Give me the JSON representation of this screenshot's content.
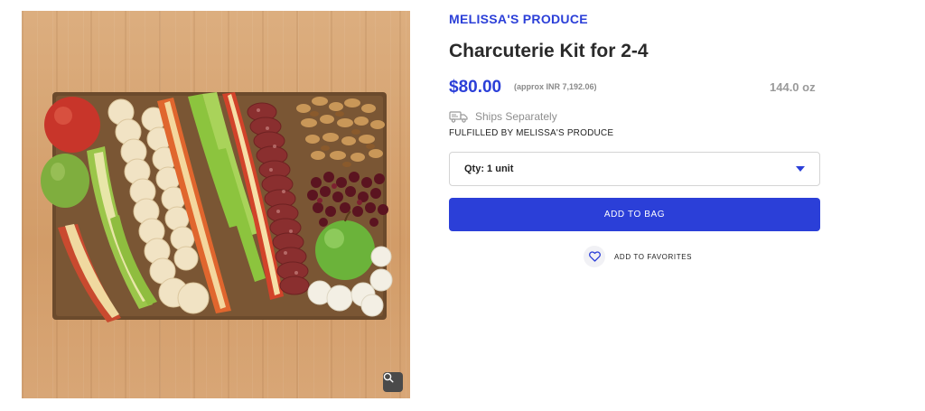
{
  "product": {
    "brand": "MELISSA'S PRODUCE",
    "title": "Charcuterie Kit for 2-4",
    "price": "$80.00",
    "approx_price": "(approx INR 7,192.06)",
    "weight": "144.0 oz",
    "ships_note": "Ships Separately",
    "fulfilled_by": "FULFILLED BY MELISSA'S PRODUCE"
  },
  "quantity": {
    "selected": "Qty: 1 unit"
  },
  "actions": {
    "add_to_bag": "ADD TO BAG",
    "add_to_favorites": "ADD TO FAVORITES"
  },
  "icons": {
    "ship": "truck-icon",
    "dropdown": "caret-down-icon",
    "favorite": "heart-icon",
    "zoom": "magnifier-icon"
  },
  "colors": {
    "accent": "#2b3fd8",
    "wood": "#d9a877",
    "muted_text": "#8e8e8e"
  }
}
